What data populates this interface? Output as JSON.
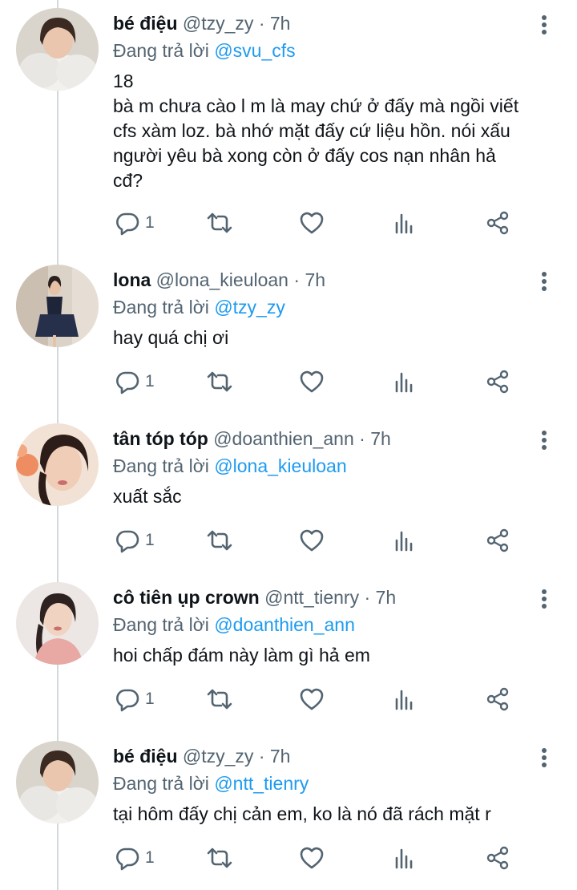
{
  "reply_prefix": "Đang trả lời",
  "tweets": [
    {
      "name": "bé điệu",
      "handle": "@tzy_zy",
      "time": "7h",
      "reply_to": "@svu_cfs",
      "text": "18\nbà m chưa cào l m là may chứ ở đấy mà ngồi viết\ncfs xàm loz. bà nhớ mặt đấy cứ liệu hồn. nói xấu\nngười yêu bà xong còn ở đấy cos nạn nhân hả\ncđ?",
      "reply_count": "1"
    },
    {
      "name": "lona",
      "handle": "@lona_kieuloan",
      "time": "7h",
      "reply_to": "@tzy_zy",
      "text": "hay quá chị ơi",
      "reply_count": "1"
    },
    {
      "name": "tân tóp tóp",
      "handle": "@doanthien_ann",
      "time": "7h",
      "reply_to": "@lona_kieuloan",
      "text": "xuất sắc",
      "reply_count": "1"
    },
    {
      "name": "cô tiên ụp crown",
      "handle": "@ntt_tienry",
      "time": "7h",
      "reply_to": "@doanthien_ann",
      "text": "hoi chấp đám này làm gì hả em",
      "reply_count": "1"
    },
    {
      "name": "bé điệu",
      "handle": "@tzy_zy",
      "time": "7h",
      "reply_to": "@ntt_tienry",
      "text": "tại hôm đấy chị cản em, ko là nó đã rách mặt r",
      "reply_count": "1"
    }
  ],
  "colors": {
    "accent": "#1d9bf0",
    "secondary_text": "#536471",
    "icon": "#536471",
    "thread_line": "#cfd9de"
  },
  "icons": {
    "more": "more-vertical-icon",
    "reply": "reply-bubble-icon",
    "retweet": "retweet-icon",
    "like": "heart-icon",
    "views": "analytics-bars-icon",
    "share": "share-icon"
  }
}
